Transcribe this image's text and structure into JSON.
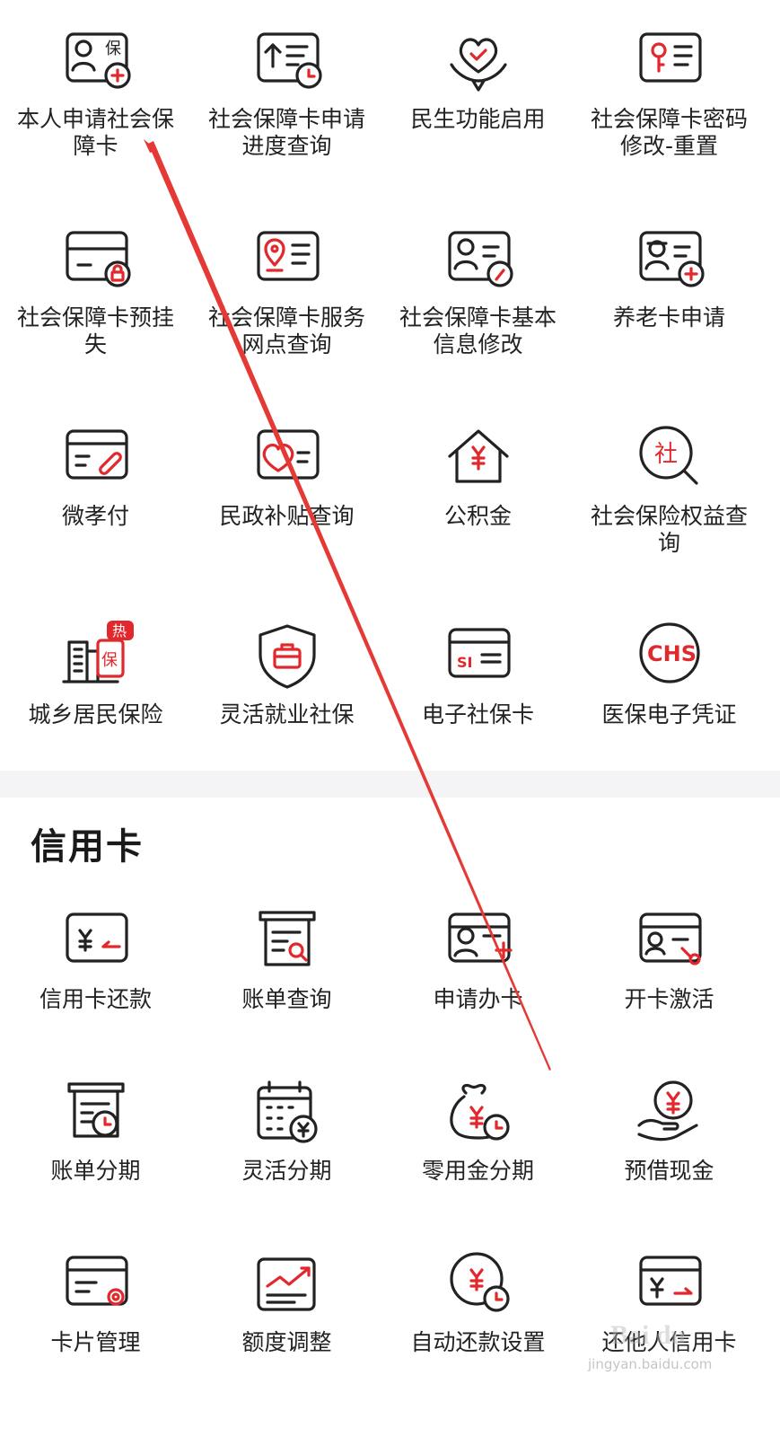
{
  "colors": {
    "accent": "#e1282c",
    "stroke": "#222222",
    "divider": "#f4f4f6",
    "arrow": "#e53935"
  },
  "social_security": {
    "items": [
      {
        "label": "本人申请社会保\n障卡",
        "icon": "insurance-card-add-icon"
      },
      {
        "label": "社会保障卡申请\n进度查询",
        "icon": "progress-query-icon"
      },
      {
        "label": "民生功能启用",
        "icon": "heart-hand-icon"
      },
      {
        "label": "社会保障卡密码\n修改-重置",
        "icon": "key-card-icon"
      },
      {
        "label": "社会保障卡预挂\n失",
        "icon": "card-lock-icon"
      },
      {
        "label": "社会保障卡服务\n网点查询",
        "icon": "location-card-icon"
      },
      {
        "label": "社会保障卡基本\n信息修改",
        "icon": "profile-edit-icon"
      },
      {
        "label": "养老卡申请",
        "icon": "elder-card-add-icon"
      },
      {
        "label": "微孝付",
        "icon": "card-link-icon"
      },
      {
        "label": "民政补贴查询",
        "icon": "heart-card-icon"
      },
      {
        "label": "公积金",
        "icon": "house-yuan-icon"
      },
      {
        "label": "社会保险权益查\n询",
        "icon": "search-she-icon"
      },
      {
        "label": "城乡居民保险",
        "icon": "buildings-icon",
        "badge": "热",
        "badge_icon_text": "保"
      },
      {
        "label": "灵活就业社保",
        "icon": "shield-briefcase-icon"
      },
      {
        "label": "电子社保卡",
        "icon": "si-card-icon",
        "icon_text": "SI"
      },
      {
        "label": "医保电子凭证",
        "icon": "chs-icon",
        "icon_text": "CHS"
      }
    ]
  },
  "credit_card": {
    "title": "信用卡",
    "items": [
      {
        "label": "信用卡还款",
        "icon": "card-repay-icon"
      },
      {
        "label": "账单查询",
        "icon": "bill-search-icon"
      },
      {
        "label": "申请办卡",
        "icon": "apply-card-icon"
      },
      {
        "label": "开卡激活",
        "icon": "activate-card-icon"
      },
      {
        "label": "账单分期",
        "icon": "bill-clock-icon"
      },
      {
        "label": "灵活分期",
        "icon": "calendar-yuan-icon"
      },
      {
        "label": "零用金分期",
        "icon": "money-bag-icon"
      },
      {
        "label": "预借现金",
        "icon": "hand-coin-icon"
      },
      {
        "label": "卡片管理",
        "icon": "card-gear-icon"
      },
      {
        "label": "额度调整",
        "icon": "chart-up-icon"
      },
      {
        "label": "自动还款设置",
        "icon": "coin-clock-icon"
      },
      {
        "label": "还他人信用卡",
        "icon": "card-transfer-icon"
      }
    ]
  },
  "watermark": {
    "text": "jingyan.baidu.com"
  }
}
